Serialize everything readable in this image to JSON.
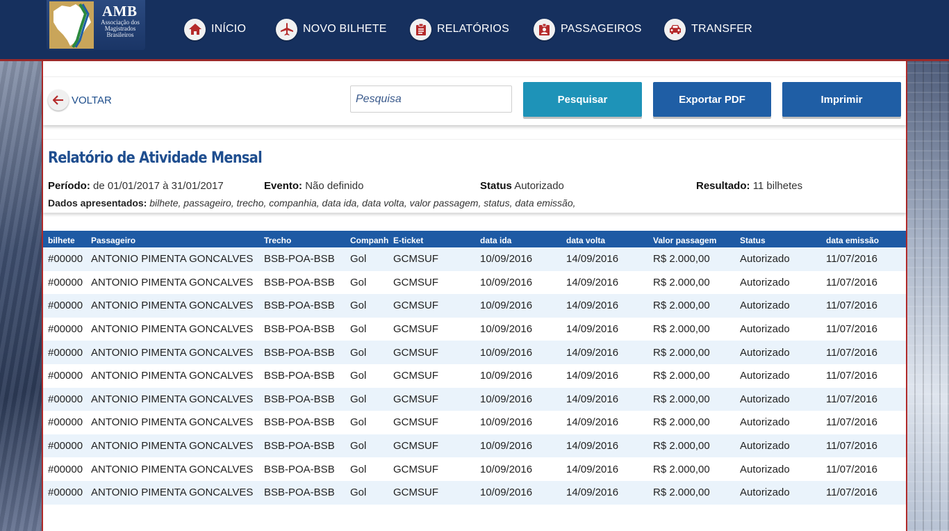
{
  "brand": {
    "title": "AMB",
    "subtitle_lines": [
      "Associação dos",
      "Magistrados",
      "Brasileiros"
    ]
  },
  "nav": [
    {
      "label": "INÍCIO",
      "icon": "home-icon"
    },
    {
      "label": "NOVO BILHETE",
      "icon": "airplane-icon"
    },
    {
      "label": "RELATÓRIOS",
      "icon": "clipboard-icon"
    },
    {
      "label": "PASSAGEIROS",
      "icon": "badge-icon"
    },
    {
      "label": "TRANSFER",
      "icon": "car-icon"
    }
  ],
  "toolbar": {
    "back_label": "VOLTAR",
    "search_placeholder": "Pesquisa",
    "search_value": "",
    "search_button": "Pesquisar",
    "pdf_button": "Exportar PDF",
    "print_button": "Imprimir"
  },
  "report": {
    "title": "Relatório de Atividade Mensal",
    "period_label": "Período:",
    "period_value": "de 01/01/2017 à 31/01/2017",
    "event_label": "Evento:",
    "event_value": "Não definido",
    "status_label": "Status",
    "status_value": "Autorizado",
    "result_label": "Resultado:",
    "result_value": "11 bilhetes",
    "shown_label": "Dados apresentados:",
    "shown_value": "bilhete, passageiro, trecho, companhia, data ida, data volta, valor passagem, status, data emissão,"
  },
  "table": {
    "columns": [
      "bilhete",
      "Passageiro",
      "Trecho",
      "Companhia",
      "E-ticket",
      "data ida",
      "data volta",
      "Valor passagem",
      "Status",
      "data emissão"
    ],
    "rows": [
      [
        "#00000",
        "ANTONIO PIMENTA GONCALVES",
        "BSB-POA-BSB",
        "Gol",
        "GCMSUF",
        "10/09/2016",
        "14/09/2016",
        "R$ 2.000,00",
        "Autorizado",
        "11/07/2016"
      ],
      [
        "#00000",
        "ANTONIO PIMENTA GONCALVES",
        "BSB-POA-BSB",
        "Gol",
        "GCMSUF",
        "10/09/2016",
        "14/09/2016",
        "R$ 2.000,00",
        "Autorizado",
        "11/07/2016"
      ],
      [
        "#00000",
        "ANTONIO PIMENTA GONCALVES",
        "BSB-POA-BSB",
        "Gol",
        "GCMSUF",
        "10/09/2016",
        "14/09/2016",
        "R$ 2.000,00",
        "Autorizado",
        "11/07/2016"
      ],
      [
        "#00000",
        "ANTONIO PIMENTA GONCALVES",
        "BSB-POA-BSB",
        "Gol",
        "GCMSUF",
        "10/09/2016",
        "14/09/2016",
        "R$ 2.000,00",
        "Autorizado",
        "11/07/2016"
      ],
      [
        "#00000",
        "ANTONIO PIMENTA GONCALVES",
        "BSB-POA-BSB",
        "Gol",
        "GCMSUF",
        "10/09/2016",
        "14/09/2016",
        "R$ 2.000,00",
        "Autorizado",
        "11/07/2016"
      ],
      [
        "#00000",
        "ANTONIO PIMENTA GONCALVES",
        "BSB-POA-BSB",
        "Gol",
        "GCMSUF",
        "10/09/2016",
        "14/09/2016",
        "R$ 2.000,00",
        "Autorizado",
        "11/07/2016"
      ],
      [
        "#00000",
        "ANTONIO PIMENTA GONCALVES",
        "BSB-POA-BSB",
        "Gol",
        "GCMSUF",
        "10/09/2016",
        "14/09/2016",
        "R$ 2.000,00",
        "Autorizado",
        "11/07/2016"
      ],
      [
        "#00000",
        "ANTONIO PIMENTA GONCALVES",
        "BSB-POA-BSB",
        "Gol",
        "GCMSUF",
        "10/09/2016",
        "14/09/2016",
        "R$ 2.000,00",
        "Autorizado",
        "11/07/2016"
      ],
      [
        "#00000",
        "ANTONIO PIMENTA GONCALVES",
        "BSB-POA-BSB",
        "Gol",
        "GCMSUF",
        "10/09/2016",
        "14/09/2016",
        "R$ 2.000,00",
        "Autorizado",
        "11/07/2016"
      ],
      [
        "#00000",
        "ANTONIO PIMENTA GONCALVES",
        "BSB-POA-BSB",
        "Gol",
        "GCMSUF",
        "10/09/2016",
        "14/09/2016",
        "R$ 2.000,00",
        "Autorizado",
        "11/07/2016"
      ],
      [
        "#00000",
        "ANTONIO PIMENTA GONCALVES",
        "BSB-POA-BSB",
        "Gol",
        "GCMSUF",
        "10/09/2016",
        "14/09/2016",
        "R$ 2.000,00",
        "Autorizado",
        "11/07/2016"
      ]
    ]
  },
  "colors": {
    "header_bg": "#16305e",
    "accent_red": "#b02a2a",
    "primary_blue": "#1f5ea5",
    "search_blue": "#1e93b8",
    "title_blue": "#1f4e8f",
    "row_stripe": "#eaf3fb"
  }
}
